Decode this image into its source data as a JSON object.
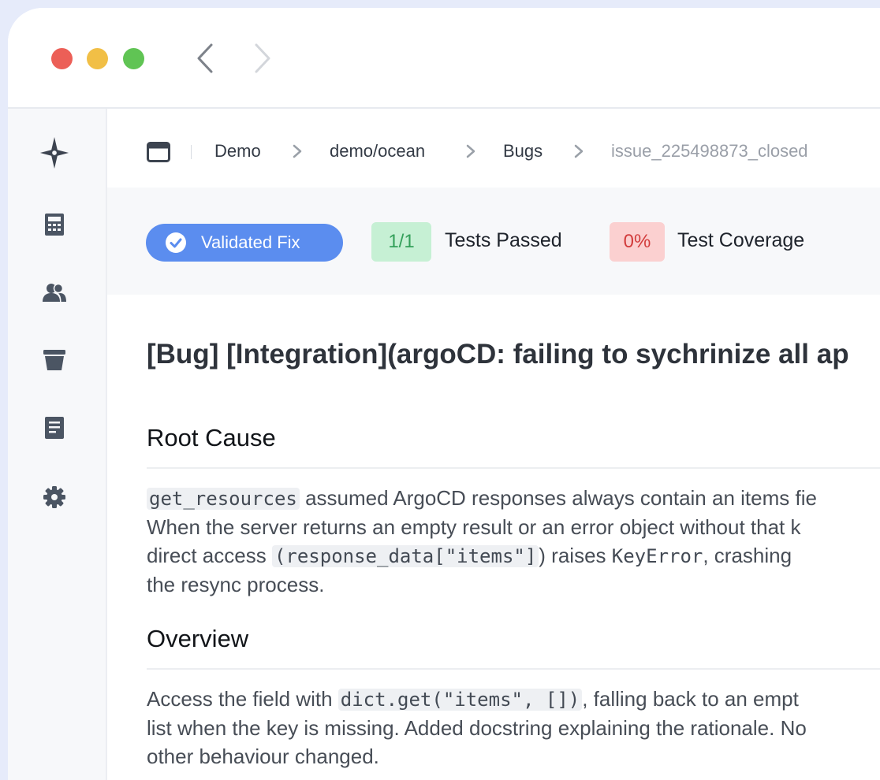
{
  "breadcrumb": {
    "items": [
      "Demo",
      "demo/ocean",
      "Bugs"
    ],
    "current": "issue_225498873_closed"
  },
  "status": {
    "validated_label": "Validated Fix",
    "tests_value": "1/1",
    "tests_label": "Tests Passed",
    "coverage_value": "0%",
    "coverage_label": "Test Coverage"
  },
  "issue": {
    "title": "[Bug] [Integration](argoCD: failing to sychrinize all ap",
    "sections": [
      {
        "heading": "Root Cause",
        "lines": [
          {
            "code": "get_resources",
            "text": " assumed ArgoCD responses always contain an items fie"
          },
          {
            "text": "When the server returns an empty result or an error object without that k"
          },
          {
            "pre": "direct access ",
            "code": "(response_data[\"items\"]",
            "mid": ") raises ",
            "code2": "KeyError",
            "post": ", crashing"
          },
          {
            "text": "the resync process."
          }
        ]
      },
      {
        "heading": "Overview",
        "lines": [
          {
            "pre": "Access the field with ",
            "code": "dict.get(\"items\", [])",
            "post": ", falling back to an empt"
          },
          {
            "text": "list when the key is missing. Added docstring explaining the rationale. No"
          },
          {
            "text": "other behaviour changed."
          }
        ]
      }
    ]
  },
  "colors": {
    "accent": "#5b8def",
    "pass_bg": "#c6f0d4",
    "pass_text": "#34a05a",
    "fail_bg": "#fbd0d0",
    "fail_text": "#d23c3c"
  },
  "icons": {
    "sidebar": [
      "compass-star-icon",
      "calculator-icon",
      "users-icon",
      "trash-icon",
      "document-icon",
      "gear-icon"
    ]
  }
}
